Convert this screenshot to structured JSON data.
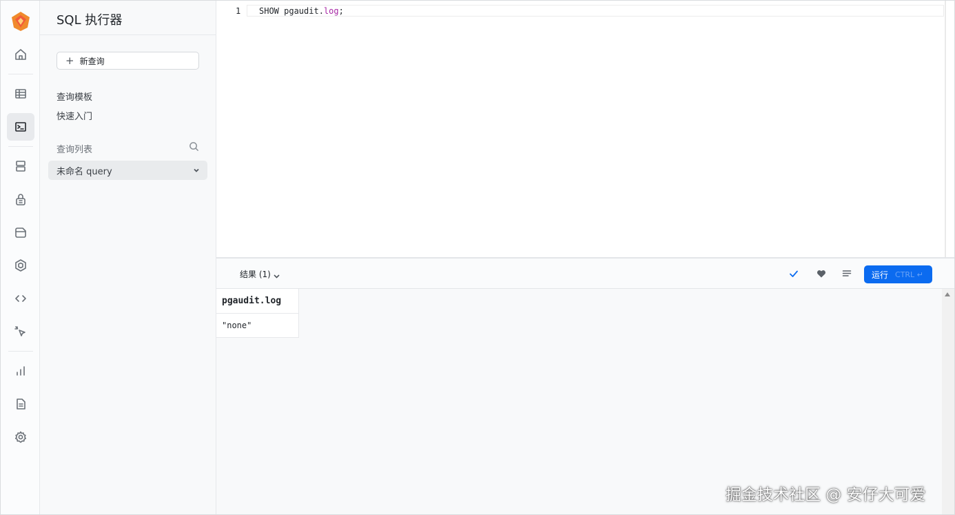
{
  "rail": {
    "items": [
      {
        "icon": "home-icon"
      },
      {
        "icon": "table-icon"
      },
      {
        "icon": "terminal-icon",
        "active": true
      },
      {
        "icon": "database-icon"
      },
      {
        "icon": "lock-icon"
      },
      {
        "icon": "storage-icon"
      },
      {
        "icon": "cube-icon"
      },
      {
        "icon": "code-icon"
      },
      {
        "icon": "cursor-icon"
      },
      {
        "icon": "chart-icon"
      },
      {
        "icon": "document-icon"
      },
      {
        "icon": "gear-icon"
      }
    ]
  },
  "sidebar": {
    "title": "SQL 执行器",
    "new_query_label": "新查询",
    "links": [
      "查询模板",
      "快速入门"
    ],
    "query_list_label": "查询列表",
    "query_item": "未命名 query"
  },
  "editor": {
    "line_number": "1",
    "code_keyword": "SHOW pgaudit.",
    "code_ident": "log",
    "code_end": ";"
  },
  "results": {
    "label": "结果 (1)",
    "run_label": "运行",
    "run_shortcut": "CTRL ↵",
    "columns": [
      "pgaudit.log"
    ],
    "rows": [
      [
        "\"none\""
      ]
    ]
  },
  "colors": {
    "accent": "#0b6bf0",
    "sql_function": "#a626a4"
  },
  "watermark": "掘金技术社区 @ 安仔大可爱"
}
